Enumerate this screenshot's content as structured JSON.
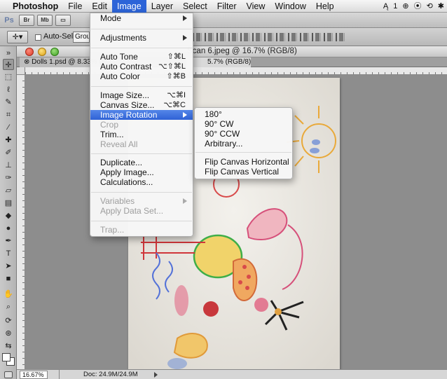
{
  "menubar": {
    "app": "Photoshop",
    "items": [
      "File",
      "Edit",
      "Image",
      "Layer",
      "Select",
      "Filter",
      "View",
      "Window",
      "Help"
    ],
    "active": "Image",
    "status_adobe": "1"
  },
  "appbar": {
    "logo": "Ps",
    "bridge": "Br",
    "minibridge": "Mb"
  },
  "options": {
    "tool_icon": "move-icon",
    "autoselect_label": "Auto-Select:",
    "autoselect_value": "Group"
  },
  "window": {
    "title": "Scan 6.jpeg @ 16.7% (RGB/8)",
    "tab1": "Dolls 1.psd @ 8.33% (R",
    "tab2": "5.7% (RGB/8)"
  },
  "status": {
    "zoom": "16.67%",
    "doc": "Doc: 24.9M/24.9M"
  },
  "image_menu": {
    "items": [
      {
        "label": "Mode",
        "shortcut": "",
        "submenu": true,
        "disabled": false
      },
      {
        "label": "Adjustments",
        "shortcut": "",
        "submenu": true,
        "disabled": false
      },
      {
        "label": "Auto Tone",
        "shortcut": "⇧⌘L",
        "submenu": false,
        "disabled": false
      },
      {
        "label": "Auto Contrast",
        "shortcut": "⌥⇧⌘L",
        "submenu": false,
        "disabled": false
      },
      {
        "label": "Auto Color",
        "shortcut": "⇧⌘B",
        "submenu": false,
        "disabled": false
      },
      {
        "label": "Image Size...",
        "shortcut": "⌥⌘I",
        "submenu": false,
        "disabled": false
      },
      {
        "label": "Canvas Size...",
        "shortcut": "⌥⌘C",
        "submenu": false,
        "disabled": false
      },
      {
        "label": "Image Rotation",
        "shortcut": "",
        "submenu": true,
        "disabled": false,
        "highlighted": true
      },
      {
        "label": "Crop",
        "shortcut": "",
        "submenu": false,
        "disabled": true
      },
      {
        "label": "Trim...",
        "shortcut": "",
        "submenu": false,
        "disabled": false
      },
      {
        "label": "Reveal All",
        "shortcut": "",
        "submenu": false,
        "disabled": true
      },
      {
        "label": "Duplicate...",
        "shortcut": "",
        "submenu": false,
        "disabled": false
      },
      {
        "label": "Apply Image...",
        "shortcut": "",
        "submenu": false,
        "disabled": false
      },
      {
        "label": "Calculations...",
        "shortcut": "",
        "submenu": false,
        "disabled": false
      },
      {
        "label": "Variables",
        "shortcut": "",
        "submenu": true,
        "disabled": true
      },
      {
        "label": "Apply Data Set...",
        "shortcut": "",
        "submenu": false,
        "disabled": true
      },
      {
        "label": "Trap...",
        "shortcut": "",
        "submenu": false,
        "disabled": true
      }
    ]
  },
  "rotation_menu": {
    "items": [
      {
        "label": "180°"
      },
      {
        "label": "90° CW"
      },
      {
        "label": "90° CCW"
      },
      {
        "label": "Arbitrary..."
      },
      {
        "label": "Flip Canvas Horizontal"
      },
      {
        "label": "Flip Canvas Vertical"
      }
    ]
  },
  "colors": {
    "highlight": "#2f62d6",
    "menubar_active": "#2d64d8",
    "workspace": "#8d8d8d",
    "paper": "#ebe8e2"
  }
}
